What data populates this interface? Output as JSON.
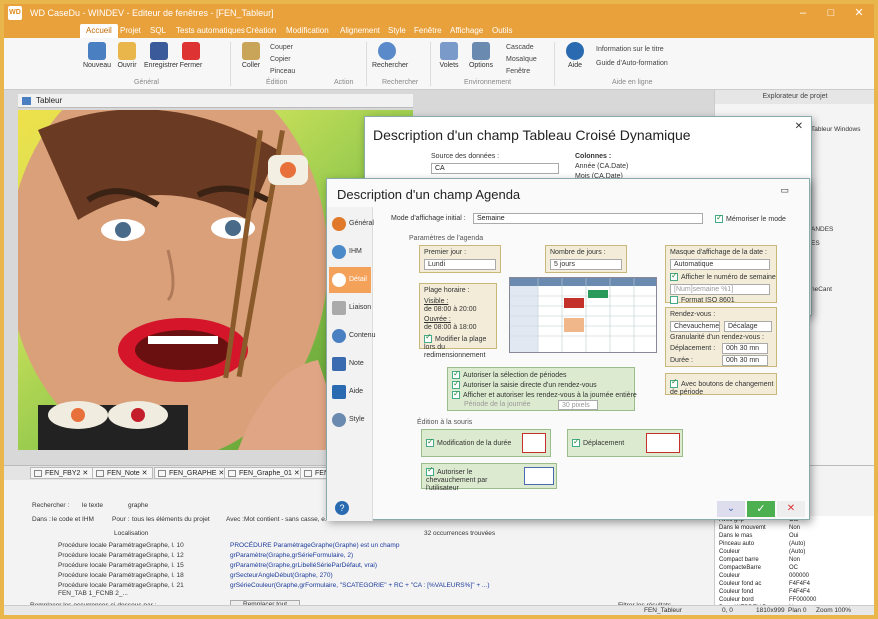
{
  "window": {
    "title": "WD CaseDu - WINDEV - Editeur de fenêtres - [FEN_Tableur]"
  },
  "menu": [
    "Accueil",
    "Projet",
    "SQL",
    "Tests automatiques",
    "Création",
    "Modification",
    "Alignement",
    "Style",
    "Fenêtre",
    "Affichage",
    "Outils"
  ],
  "ribbon": {
    "buttons": [
      "Nouveau",
      "Ouvrir",
      "Enregistrer",
      "Fermer",
      "Coller",
      "Rechercher",
      "Volets",
      "Options",
      "Aide"
    ],
    "small": [
      "Couper",
      "Copier",
      "Pinceau",
      "Cascade",
      "Mosaïque",
      "Fenêtre",
      "Information sur le titre",
      "Guide d'Auto-formation"
    ],
    "groups": [
      "Général",
      "Édition",
      "Action",
      "Rechercher",
      "Environnement",
      "Aide en ligne"
    ]
  },
  "tab_title": "Tableur",
  "project_explorer": {
    "title": "Explorateur de projet",
    "items": [
      "Tableur Windows",
      "ANDES",
      "ES",
      "neCant"
    ]
  },
  "dlg_tableau": {
    "title": "Description d'un champ Tableau Croisé Dynamique",
    "source_label": "Source des données :",
    "source_value": "CA",
    "columns_label": "Colonnes :",
    "columns": [
      "Année (CA.Date)",
      "Mois (CA.Date)"
    ]
  },
  "dlg_agenda": {
    "title": "Description d'un champ Agenda",
    "side": [
      "Général",
      "IHM",
      "Détail",
      "Liaison",
      "Contenu",
      "Note",
      "Aide",
      "Style"
    ],
    "mode_label": "Mode d'affichage initial :",
    "mode_value": "Semaine",
    "memo_label": "Mémoriser le mode",
    "params_title": "Paramètres de l'agenda",
    "first_day_label": "Premier jour :",
    "first_day_value": "Lundi",
    "nbdays_label": "Nombre de jours :",
    "nbdays_value": "5 jours",
    "date_display_label": "Masque d'affichage de la date :",
    "date_display_value": "Automatique",
    "week_num_label": "Afficher le numéro de semaine",
    "week_mask": "[Num]semaine %1]",
    "format_label": "Format ISO 8601",
    "hours_title": "Plage horaire :",
    "visible_label": "Visible :",
    "visible_value": "de 08:00 à 20:00",
    "resize_label": "Modifier la plage lors du redimensionnement",
    "ouvre_label": "Ouvrée :",
    "ouvre_value": "de 08:00 à 18:00",
    "move_label": "Rendez-vous :",
    "move_value": "Chevauchement",
    "offset_label": "Décalage",
    "gran_label": "Granularité d'un rendez-vous :",
    "dep_label": "Déplacement :",
    "dep_value": "00h 30 mn",
    "dur_label": "Durée :",
    "dur_value": "00h 30 mn",
    "btn_label": "Avec boutons de changement de période",
    "sel_label": "Autoriser la sélection de périodes",
    "sel2_label": "Autoriser la saisie directe d'un rendez-vous",
    "sel3_label": "Afficher et autoriser les rendez-vous à la journée entière",
    "sel4_label": "Période de la journée",
    "sel4_value": "30 pixels",
    "edit_title": "Édition à la souris",
    "edit1": "Modification de la durée",
    "edit2": "Déplacement",
    "edit3": "Autoriser le chevauchement par l'utilisateur",
    "ok": "✓",
    "cancel": "✕",
    "expand": "⌄"
  },
  "file_tabs": [
    "FEN_FBY2",
    "FEN_Note",
    "FEN_GRAPHE",
    "FEN_Graphe_01",
    "FEN_"
  ],
  "search": {
    "label": "Rechercher :",
    "scope": "le texte",
    "value": "graphe",
    "where_label": "Dans :",
    "where": "le code et IHM",
    "for_label": "Pour :",
    "for": "tous les éléments du projet",
    "with_label": "Avec :",
    "with": "Mot contient - sans casse, e...",
    "col_location": "Localisation",
    "occurrences": "32 occurrences trouvées",
    "rows_left": [
      "Procédure locale ParamétrageGraphe, l. 10",
      "Procédure locale ParamétrageGraphe, l. 12",
      "Procédure locale ParamétrageGraphe, l. 15",
      "Procédure locale ParamétrageGraphe, l. 18",
      "Procédure locale ParamétrageGraphe, l. 21",
      "FEN_TAB 1_FCNB 2_..."
    ],
    "rows_right": [
      "PROCÉDURE ParamètrageGraphe(Graphe) est un champ",
      "grParamètre(Graphe,grSérieFormulaire, 2)",
      "grParamètre(Graphe,grLibelléSérieParDéfaut, vrai)",
      "grSecteurAngleDébut(Graphe, 270)",
      "grSérieCouleur(Graphe,grFormulaire, \"SCATEGORIE\" + RC + \"CA : [%VALEURS%]\" + ...)"
    ],
    "replace_label": "Remplacer les occurrences ci-dessous par :",
    "replace_btn": "Remplacer tout",
    "filter_btn": "Filtrer les résultats"
  },
  "properties": [
    [
      "Avec grip",
      "Oui"
    ],
    [
      "Dans le mouvemt",
      "Non"
    ],
    [
      "Dans le mas",
      "Oui"
    ],
    [
      "Pinceau auto",
      "(Auto)"
    ],
    [
      "Couleur",
      "(Auto)"
    ],
    [
      "Compact barre",
      "Non"
    ],
    [
      "CompacteBarre",
      "OC"
    ],
    [
      "Couleur",
      "000000"
    ],
    [
      "Couleur fond ac",
      "F4F4F4"
    ],
    [
      "Couleur fond",
      "F4F4F4"
    ],
    [
      "Couleur bord",
      "FF000000"
    ],
    [
      "Dans WEBDEV Par",
      "Non"
    ]
  ],
  "status": {
    "win": "FEN_Tableur",
    "coord": "0, 0",
    "size": "1810x999",
    "plan": "Plan 0",
    "zoom": "Zoom 100%"
  },
  "colors": {
    "accent": "#e9a13c",
    "panel_bg": "#f3ecd9",
    "green_bg": "#dcebcf"
  }
}
